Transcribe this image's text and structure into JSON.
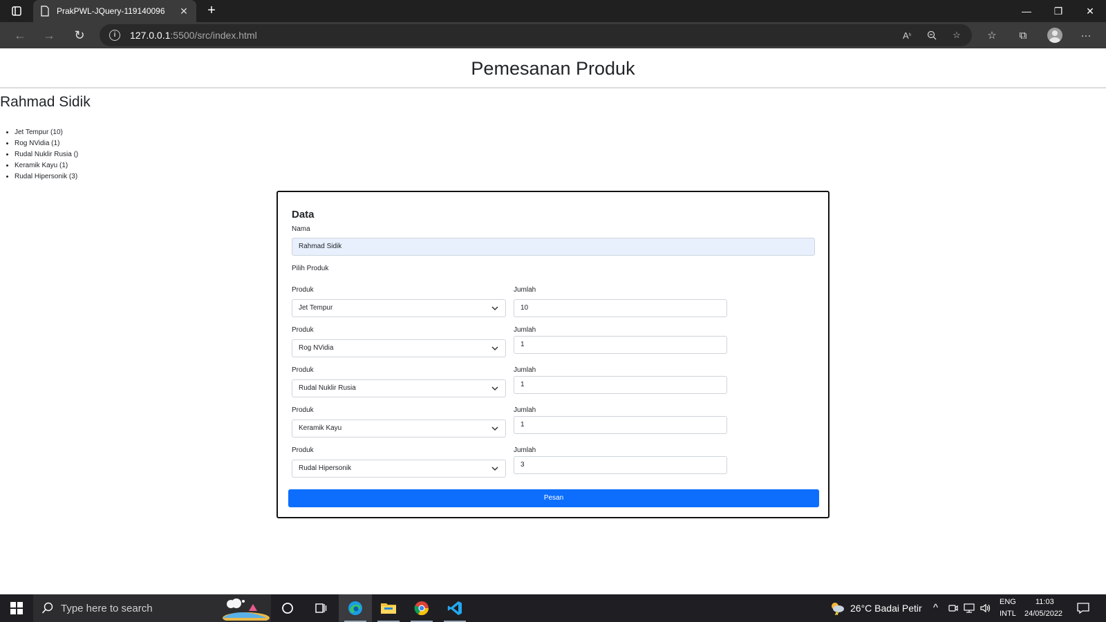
{
  "browser": {
    "tab_title": "PrakPWL-JQuery-119140096",
    "url_host": "127.0.0.1",
    "url_path": ":5500/src/index.html"
  },
  "page": {
    "title": "Pemesanan Produk",
    "customer_name": "Rahmad Sidik",
    "orders": [
      "Jet Tempur (10)",
      "Rog NVidia (1)",
      "Rudal Nuklir Rusia ()",
      "Keramik Kayu (1)",
      "Rudal Hipersonik (3)"
    ]
  },
  "form": {
    "heading": "Data",
    "name_label": "Nama",
    "name_value": "Rahmad Sidik",
    "choose_label": "Pilih Produk",
    "product_label": "Produk",
    "qty_label": "Jumlah",
    "rows": [
      {
        "product": "Jet Tempur",
        "qty": "10"
      },
      {
        "product": "Rog NVidia",
        "qty": "1"
      },
      {
        "product": "Rudal Nuklir Rusia",
        "qty": "1"
      },
      {
        "product": "Keramik Kayu",
        "qty": "1"
      },
      {
        "product": "Rudal Hipersonik",
        "qty": "3"
      }
    ],
    "submit_label": "Pesan"
  },
  "taskbar": {
    "search_placeholder": "Type here to search",
    "weather": "26°C  Badai Petir",
    "lang_top": "ENG",
    "lang_bottom": "INTL",
    "time": "11:03",
    "date": "24/05/2022"
  },
  "colors": {
    "primary_button": "#0d6efd",
    "autofill_bg": "#e8f0fe"
  }
}
